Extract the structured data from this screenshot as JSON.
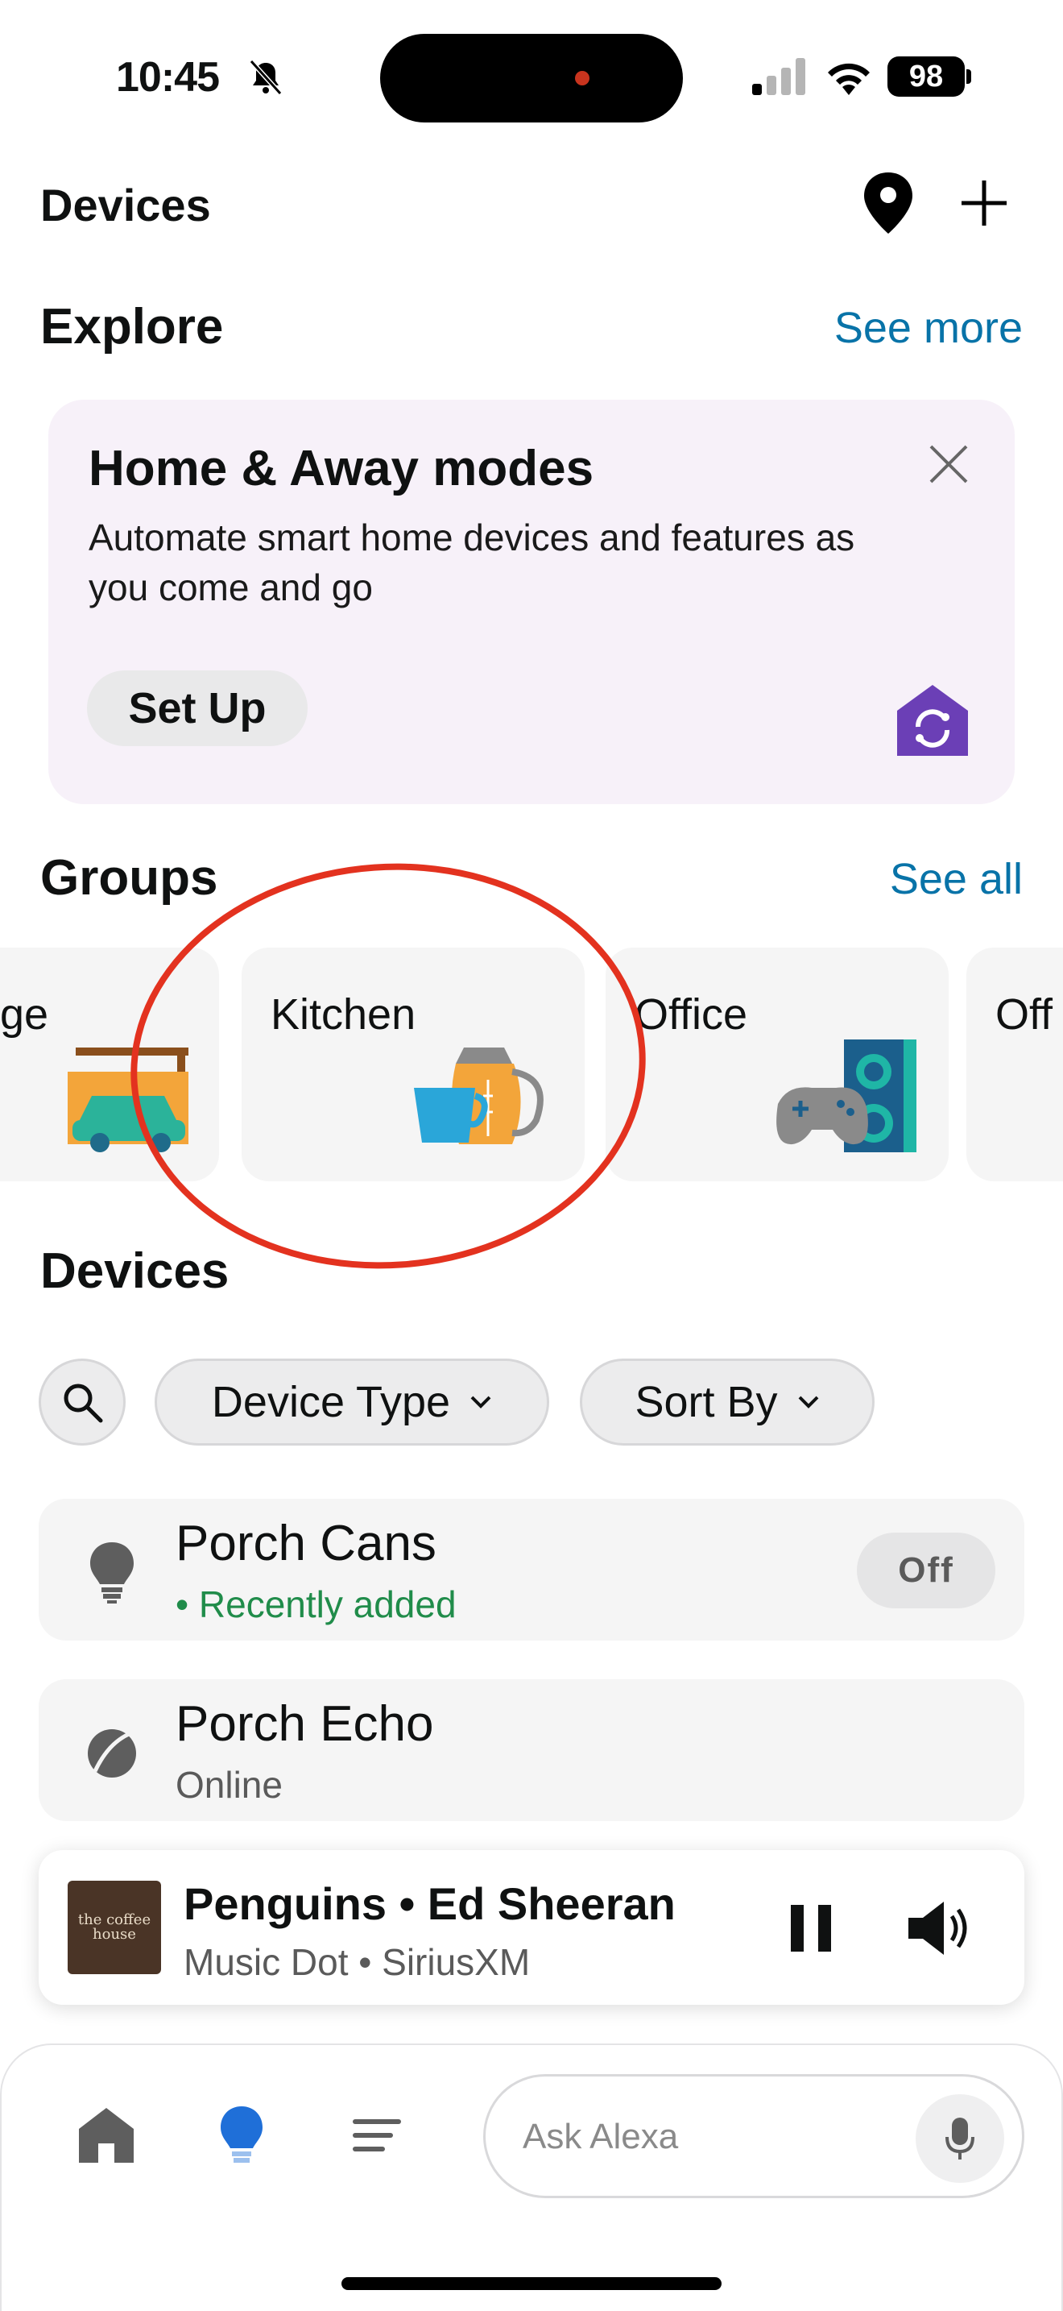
{
  "status_bar": {
    "time": "10:45",
    "battery": "98"
  },
  "header": {
    "title": "Devices"
  },
  "explore": {
    "title": "Explore",
    "see_more": "See more",
    "promo": {
      "title": "Home & Away modes",
      "body": "Automate smart home devices and features as you come and go",
      "button": "Set Up"
    }
  },
  "groups": {
    "title": "Groups",
    "see_all": "See all",
    "items": [
      {
        "label": "ge"
      },
      {
        "label": "Kitchen"
      },
      {
        "label": "Office"
      },
      {
        "label": "Off"
      }
    ]
  },
  "devices": {
    "title": "Devices",
    "filters": {
      "device_type": "Device Type",
      "sort_by": "Sort By"
    },
    "items": [
      {
        "name": "Porch Cans",
        "status": "Recently added",
        "toggle": "Off"
      },
      {
        "name": "Porch Echo",
        "status": "Online"
      }
    ]
  },
  "now_playing": {
    "title": "Penguins • Ed Sheeran",
    "subtitle": "Music Dot • SiriusXM",
    "album_art_text": "the coffee house"
  },
  "bottom_nav": {
    "ask_placeholder": "Ask Alexa"
  },
  "colors": {
    "accent_link": "#0873a8",
    "status_green": "#208c4a",
    "promo_bg": "#f7f1f9",
    "annotation_red": "#e3321f"
  }
}
